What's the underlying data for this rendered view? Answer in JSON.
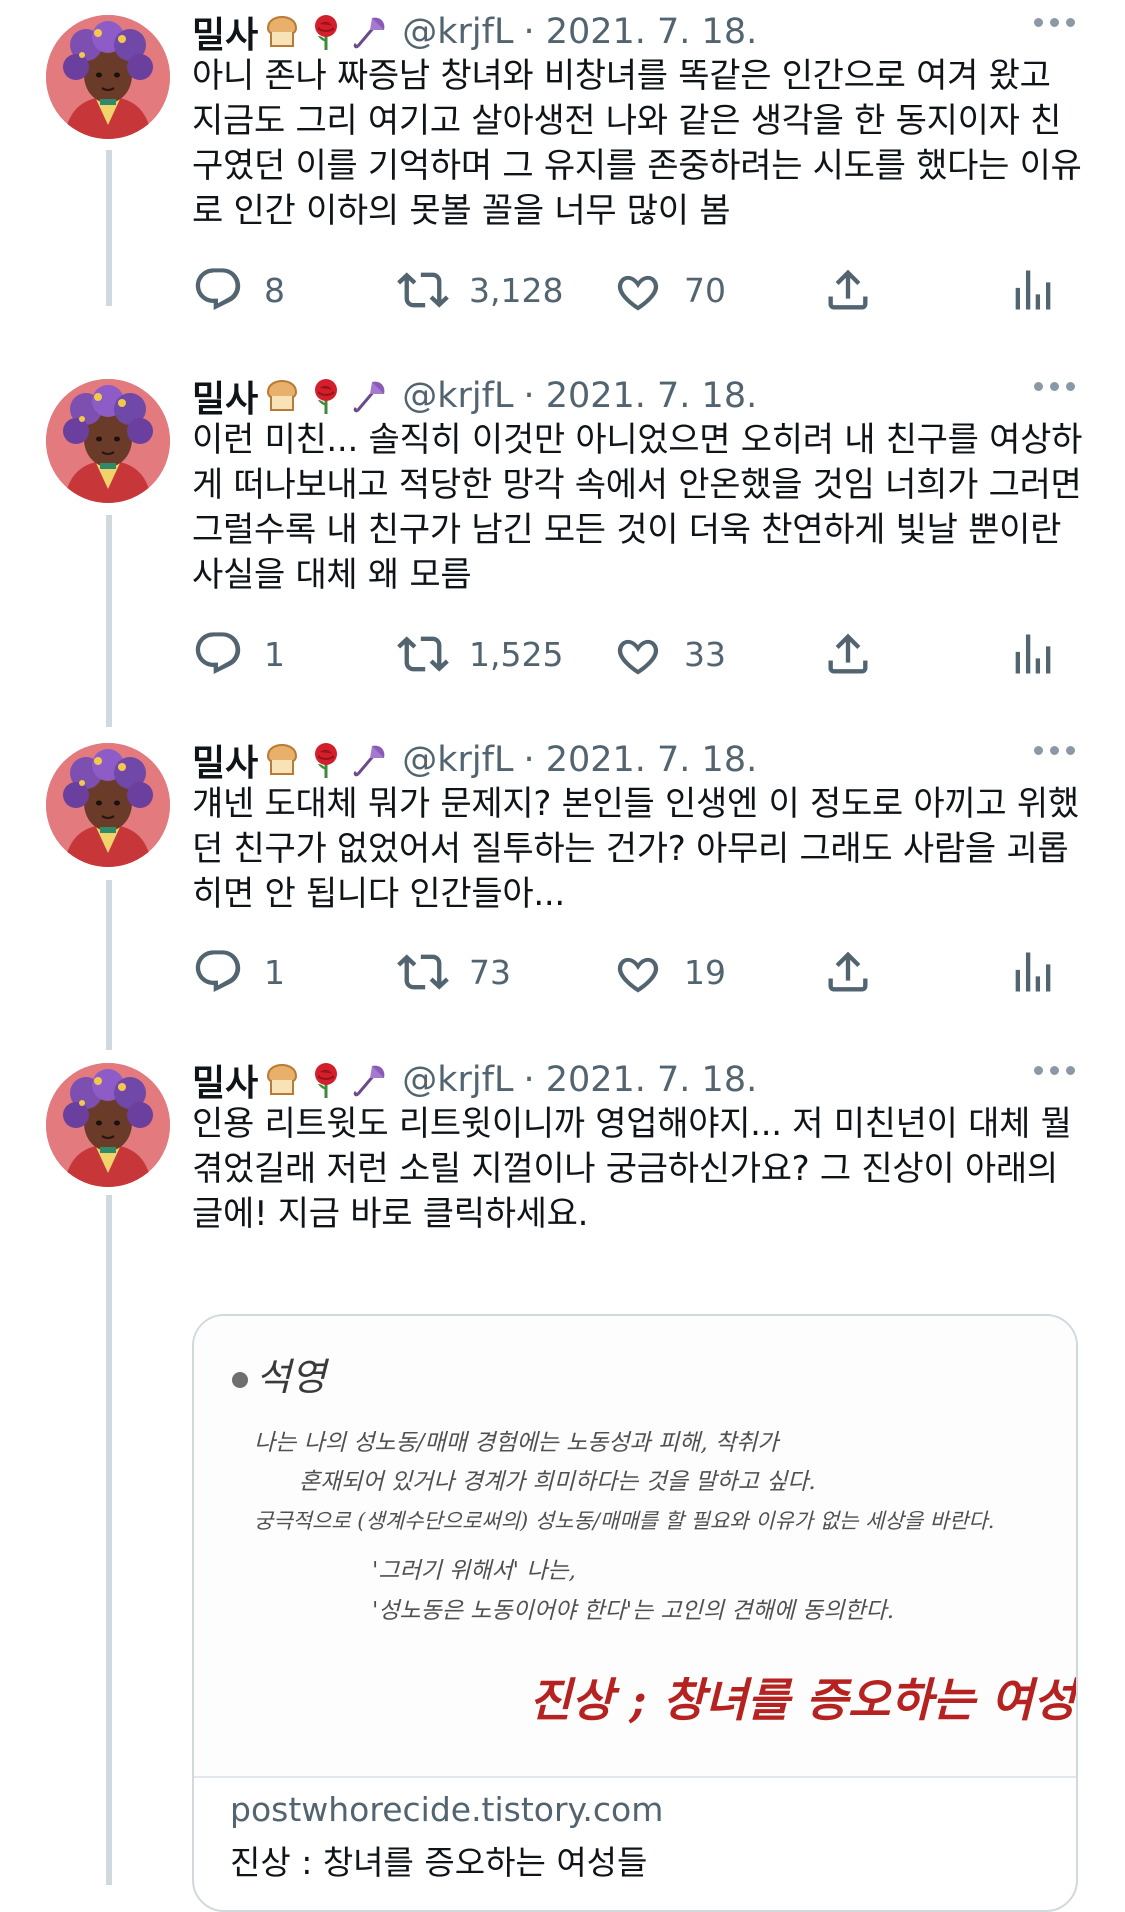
{
  "user": {
    "name": "밀사",
    "handle": "@krjfL",
    "emojis": [
      "bread-emoji",
      "rose-emoji",
      "umbrella-emoji"
    ]
  },
  "tweets": [
    {
      "date": "· 2021. 7. 18.",
      "lines": [
        "아니 존나 짜증남 창녀와 비창녀를 똑같은 인간으로 여겨 왔고",
        "지금도 그리 여기고 살아생전 나와 같은 생각을 한 동지이자 친",
        "구였던 이를 기억하며 그 유지를 존중하려는 시도를 했다는 이유",
        "로 인간 이하의 못볼 꼴을 너무 많이 봄"
      ],
      "replies": "8",
      "retweets": "3,128",
      "likes": "70"
    },
    {
      "date": "· 2021. 7. 18.",
      "lines": [
        "이런 미친... 솔직히 이것만 아니었으면 오히려 내 친구를 여상하",
        "게 떠나보내고 적당한 망각 속에서 안온했을 것임 너희가 그러면",
        "그럴수록 내 친구가 남긴 모든 것이 더욱 찬연하게 빛날 뿐이란",
        "사실을 대체 왜 모름"
      ],
      "replies": "1",
      "retweets": "1,525",
      "likes": "33"
    },
    {
      "date": "· 2021. 7. 18.",
      "lines": [
        "걔넨 도대체 뭐가 문제지? 본인들 인생엔 이 정도로 아끼고 위했",
        "던 친구가 없었어서 질투하는 건가? 아무리 그래도 사람을 괴롭",
        "히면 안 됩니다 인간들아..."
      ],
      "replies": "1",
      "retweets": "73",
      "likes": "19"
    },
    {
      "date": "· 2021. 7. 18.",
      "lines": [
        "인용 리트윗도 리트윗이니까 영업해야지... 저 미친년이 대체 뭘",
        "겪었길래 저런 소릴 지껄이나 궁금하신가요? 그 진상이 아래의",
        "글에! 지금 바로 클릭하세요."
      ],
      "card": {
        "image": {
          "heading": "석영",
          "lines": [
            "나는 나의 성노동/매매 경험에는 노동성과 피해, 착취가",
            "혼재되어 있거나 경계가 희미하다는 것을 말하고 싶다.",
            "궁극적으로 (생계수단으로써의) 성노동/매매를 할 필요와 이유가 없는 세상을 바란다.",
            "'그러기 위해서' 나는,",
            "'성노동은 노동이어야 한다'는 고인의 견해에 동의한다."
          ],
          "red_caption": "진상 ; 창녀를 증오하는 여성들"
        },
        "domain": "postwhorecide.tistory.com",
        "title": "진상 : 창녀를 증오하는 여성들"
      }
    }
  ],
  "colors": {
    "text": "#0f1419",
    "secondary": "#536471",
    "thread_line": "#cfd9de",
    "red_caption": "#b5221f",
    "avatar_bg": "#e37a7e"
  }
}
